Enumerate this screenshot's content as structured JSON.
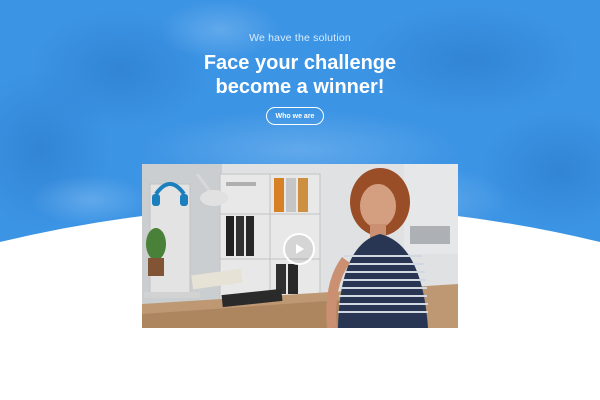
{
  "hero": {
    "eyebrow": "We have the solution",
    "headline_line1": "Face your challenge",
    "headline_line2": "become a winner!",
    "cta_label": "Who we are"
  },
  "video": {
    "play_icon": "play-icon"
  },
  "colors": {
    "hero_blue": "#3c94e4",
    "hero_blue_dark": "#2f7fd0",
    "text_white": "#ffffff",
    "eyebrow": "#d9ecff"
  }
}
